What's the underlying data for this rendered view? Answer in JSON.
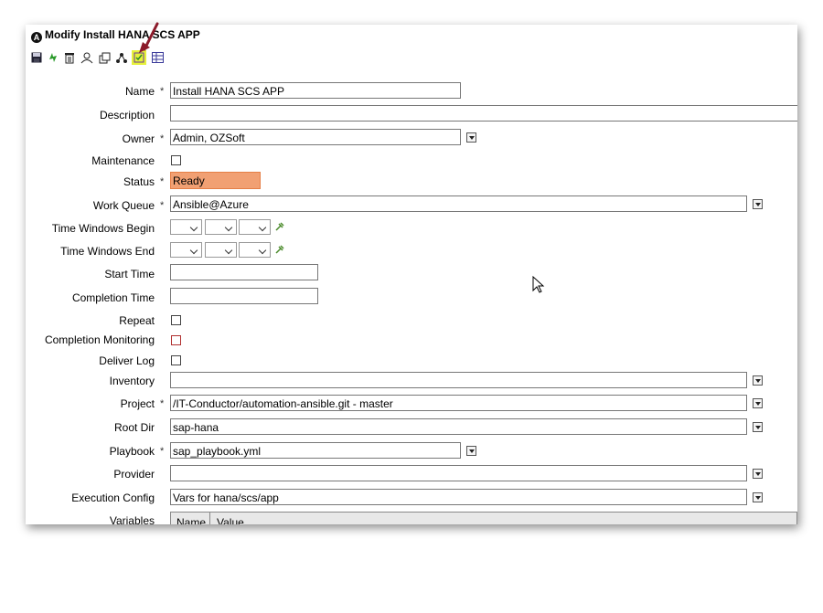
{
  "window": {
    "title": "Modify Install HANA SCS APP",
    "title_icon_letter": "A"
  },
  "toolbar": {
    "buttons": [
      "save-icon",
      "refresh-icon",
      "delete-icon",
      "user-icon",
      "copy-icon",
      "hierarchy-icon",
      "checklist-icon",
      "grid-icon"
    ],
    "highlighted_color": "#e6f13a"
  },
  "form": {
    "name": {
      "label": "Name",
      "value": "Install HANA SCS APP"
    },
    "description": {
      "label": "Description",
      "value": ""
    },
    "owner": {
      "label": "Owner",
      "value": "Admin, OZSoft"
    },
    "maintenance": {
      "label": "Maintenance",
      "checked": false
    },
    "status": {
      "label": "Status",
      "value": "Ready",
      "color": "#f1a073"
    },
    "work_queue": {
      "label": "Work Queue",
      "value": "Ansible@Azure"
    },
    "tw_begin": {
      "label": "Time Windows Begin"
    },
    "tw_end": {
      "label": "Time Windows End"
    },
    "start_time": {
      "label": "Start Time",
      "value": ""
    },
    "completion_time": {
      "label": "Completion Time",
      "value": ""
    },
    "repeat": {
      "label": "Repeat",
      "checked": false
    },
    "completion_monitoring": {
      "label": "Completion Monitoring",
      "checked": false
    },
    "deliver_log": {
      "label": "Deliver Log",
      "checked": false
    },
    "inventory": {
      "label": "Inventory",
      "value": ""
    },
    "project": {
      "label": "Project",
      "value": "/IT-Conductor/automation-ansible.git - master"
    },
    "root_dir": {
      "label": "Root Dir",
      "value": "sap-hana"
    },
    "playbook": {
      "label": "Playbook",
      "value": "sap_playbook.yml"
    },
    "provider": {
      "label": "Provider",
      "value": ""
    },
    "execution_config": {
      "label": "Execution Config",
      "value": "Vars for hana/scs/app"
    },
    "variables": {
      "label": "Variables",
      "columns": [
        "Name",
        "Value"
      ]
    },
    "required_mark": "*"
  }
}
